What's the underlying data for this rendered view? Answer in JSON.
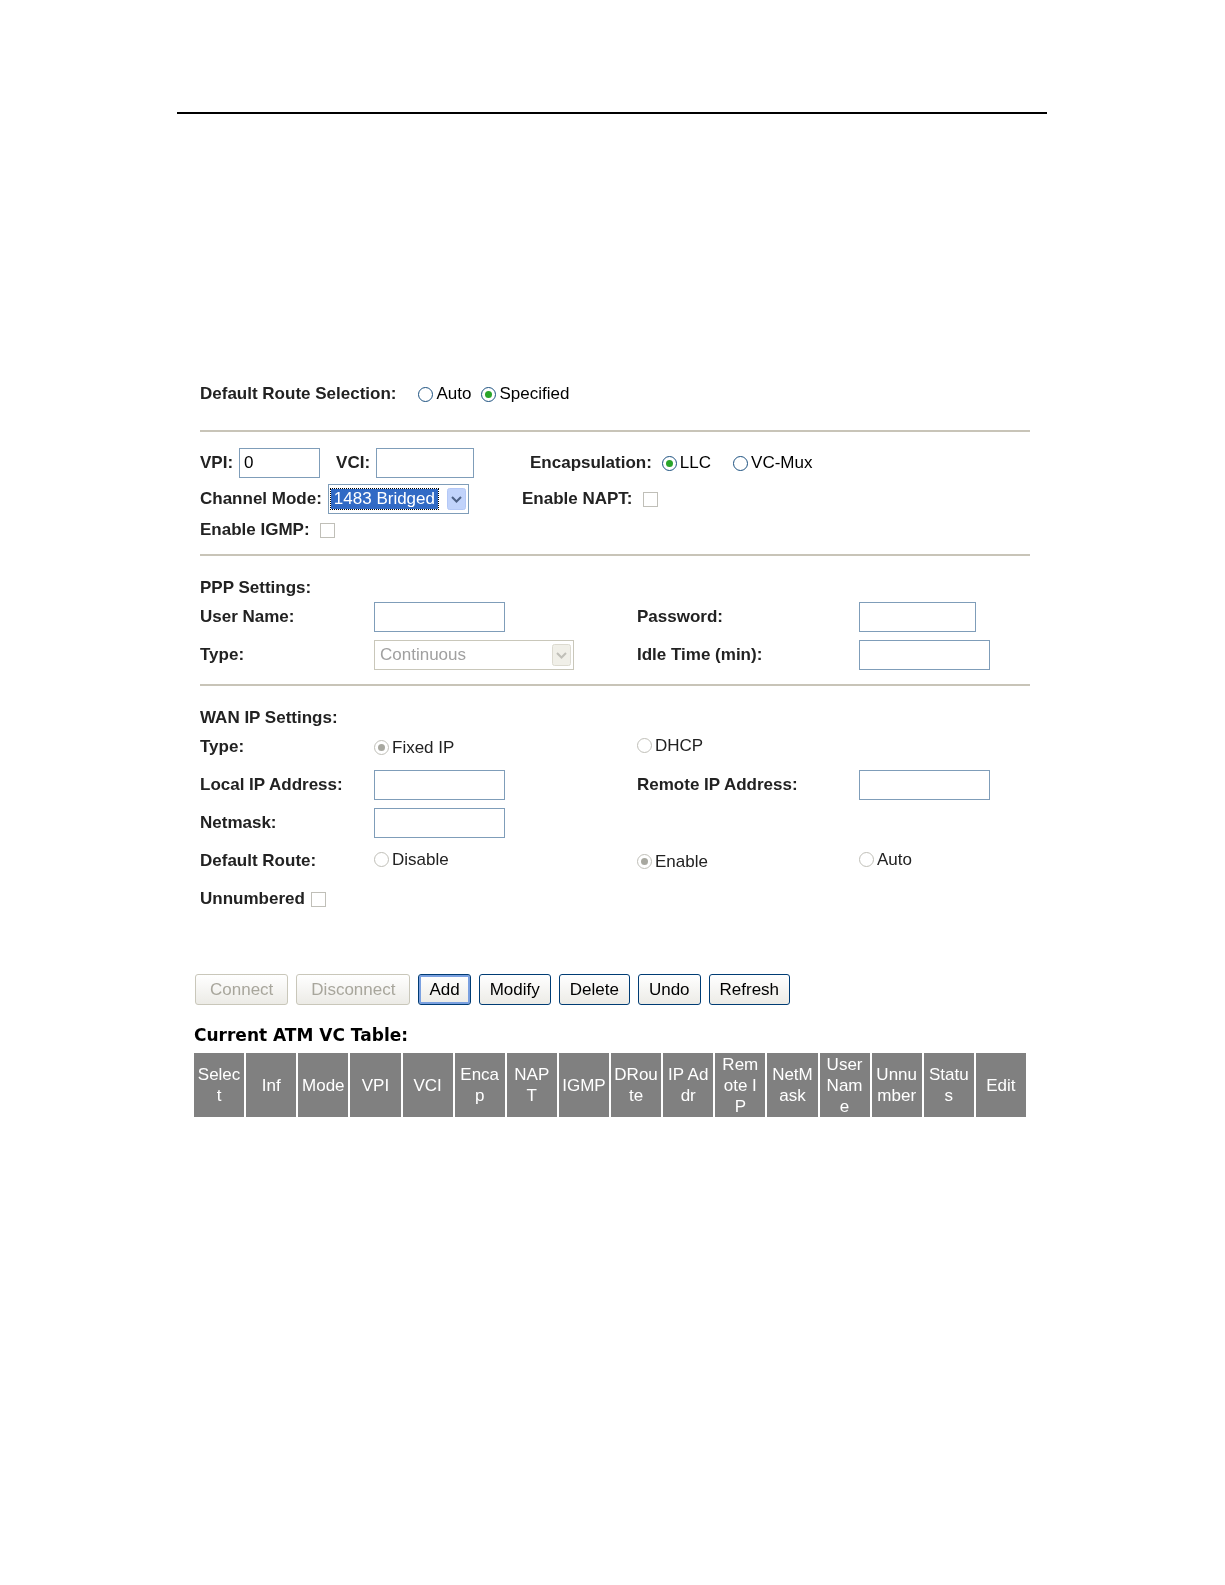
{
  "default_route_selection": {
    "label": "Default Route Selection:",
    "options": [
      {
        "label": "Auto",
        "selected": false
      },
      {
        "label": "Specified",
        "selected": true
      }
    ]
  },
  "atm": {
    "vpi": {
      "label": "VPI:",
      "value": "0"
    },
    "vci": {
      "label": "VCI:"
    },
    "encapsulation": {
      "label": "Encapsulation:",
      "options": [
        {
          "label": "LLC",
          "selected": true
        },
        {
          "label": "VC-Mux",
          "selected": false
        }
      ]
    },
    "channel_mode": {
      "label": "Channel Mode:",
      "value": "1483 Bridged",
      "highlighted": true
    },
    "enable_napt": {
      "label": "Enable NAPT:",
      "checked": false
    },
    "enable_igmp": {
      "label": "Enable IGMP:",
      "checked": false
    }
  },
  "ppp_settings": {
    "title": "PPP Settings:",
    "user_name": {
      "label": "User Name:"
    },
    "password": {
      "label": "Password:"
    },
    "type": {
      "label": "Type:",
      "value": "Continuous",
      "disabled": true
    },
    "idle_time": {
      "label": "Idle Time (min):"
    }
  },
  "wan_ip_settings": {
    "title": "WAN IP Settings:",
    "type": {
      "label": "Type:",
      "disabled": true,
      "options": [
        {
          "label": "Fixed IP",
          "selected": true
        },
        {
          "label": "DHCP",
          "selected": false
        }
      ]
    },
    "local_ip": {
      "label": "Local IP Address:"
    },
    "remote_ip": {
      "label": "Remote IP Address:"
    },
    "netmask": {
      "label": "Netmask:"
    },
    "default_route": {
      "label": "Default Route:",
      "disabled": true,
      "options": [
        {
          "label": "Disable",
          "selected": false
        },
        {
          "label": "Enable",
          "selected": true
        },
        {
          "label": "Auto",
          "selected": false
        }
      ]
    },
    "unnumbered": {
      "label": "Unnumbered",
      "checked": false
    }
  },
  "buttons": [
    {
      "label": "Connect",
      "disabled": true,
      "focused": false
    },
    {
      "label": "Disconnect",
      "disabled": true,
      "focused": false
    },
    {
      "label": "Add",
      "disabled": false,
      "focused": true
    },
    {
      "label": "Modify",
      "disabled": false,
      "focused": false
    },
    {
      "label": "Delete",
      "disabled": false,
      "focused": false
    },
    {
      "label": "Undo",
      "disabled": false,
      "focused": false
    },
    {
      "label": "Refresh",
      "disabled": false,
      "focused": false
    }
  ],
  "vc_table": {
    "title": "Current ATM VC Table:",
    "columns": [
      "Select",
      "Inf",
      "Mode",
      "VPI",
      "VCI",
      "Encap",
      "NAPT",
      "IGMP",
      "DRoute",
      "IP Addr",
      "Remote IP",
      "NetMask",
      "User Name",
      "Unnumber",
      "Status",
      "Edit"
    ]
  }
}
